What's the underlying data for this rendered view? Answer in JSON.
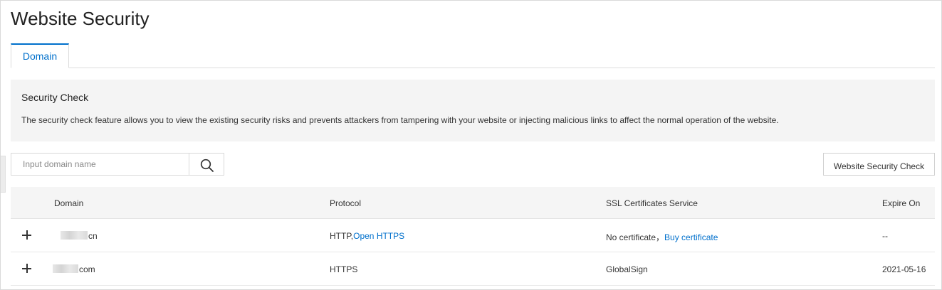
{
  "page": {
    "title": "Website Security"
  },
  "tabs": [
    {
      "label": "Domain",
      "active": true
    }
  ],
  "info": {
    "title": "Security Check",
    "description": "The security check feature allows you to view the existing security risks and prevents attackers from tampering with your website or injecting malicious links to affect the normal operation of the website."
  },
  "search": {
    "placeholder": "Input domain name",
    "value": "",
    "icon": "search-icon"
  },
  "actions": {
    "check_label": "Website Security Check"
  },
  "table": {
    "columns": [
      "Domain",
      "Protocol",
      "SSL Certificates Service",
      "Expire On"
    ],
    "rows": [
      {
        "domain_suffix": "cn",
        "protocol": "HTTP,",
        "protocol_link": "Open HTTPS",
        "ssl": "No certificate，",
        "ssl_link": "Buy certificate",
        "expire": "--"
      },
      {
        "domain_suffix": "com",
        "protocol": "HTTPS",
        "protocol_link": "",
        "ssl": "GlobalSign",
        "ssl_link": "",
        "expire": "2021-05-16"
      }
    ]
  },
  "colors": {
    "accent": "#0070cc",
    "panel_bg": "#f4f4f4"
  }
}
